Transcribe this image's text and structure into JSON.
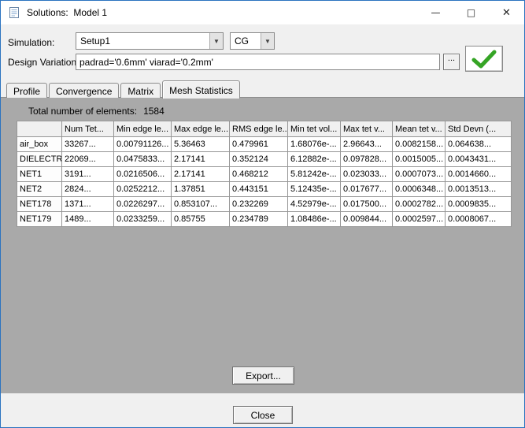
{
  "window": {
    "title": "Solutions:  Model 1",
    "minimize_glyph": "—",
    "maximize_glyph": "□",
    "close_glyph": "✕"
  },
  "icons": {
    "dropdown_arrow": "▼",
    "browse_ellipsis": "..."
  },
  "toolbar": {
    "simulation_label": "Simulation:",
    "simulation_value": "Setup1",
    "solution_type_value": "CG",
    "design_variation_label": "Design Variation:",
    "design_variation_value": "padrad='0.6mm' viarad='0.2mm'",
    "accent_green": "#35a425"
  },
  "tabs": [
    {
      "label": "Profile",
      "selected": false
    },
    {
      "label": "Convergence",
      "selected": false
    },
    {
      "label": "Matrix",
      "selected": false
    },
    {
      "label": "Mesh Statistics",
      "selected": true
    }
  ],
  "mesh_statistics": {
    "total_label": "Total number of elements:",
    "total_value": "1584",
    "columns": [
      "",
      "Num Tet...",
      "Min edge le...",
      "Max edge le...",
      "RMS edge le...",
      "Min tet vol...",
      "Max tet v...",
      "Mean tet v...",
      "Std Devn (..."
    ],
    "rows": [
      {
        "name": "air_box",
        "values": [
          "33267...",
          "0.00791126...",
          "5.36463",
          "0.479961",
          "1.68076e-...",
          "2.96643...",
          "0.0082158...",
          "0.064638..."
        ]
      },
      {
        "name": "DIELECTRIC",
        "values": [
          "22069...",
          "0.0475833...",
          "2.17141",
          "0.352124",
          "6.12882e-...",
          "0.097828...",
          "0.0015005...",
          "0.0043431..."
        ]
      },
      {
        "name": "NET1",
        "values": [
          "3191...",
          "0.0216506...",
          "2.17141",
          "0.468212",
          "5.81242e-...",
          "0.023033...",
          "0.0007073...",
          "0.0014660..."
        ]
      },
      {
        "name": "NET2",
        "values": [
          "2824...",
          "0.0252212...",
          "1.37851",
          "0.443151",
          "5.12435e-...",
          "0.017677...",
          "0.0006348...",
          "0.0013513..."
        ]
      },
      {
        "name": "NET178",
        "values": [
          "1371...",
          "0.0226297...",
          "0.853107...",
          "0.232269",
          "4.52979e-...",
          "0.017500...",
          "0.0002782...",
          "0.0009835..."
        ]
      },
      {
        "name": "NET179",
        "values": [
          "1489...",
          "0.0233259...",
          "0.85755",
          "0.234789",
          "1.08486e-...",
          "0.009844...",
          "0.0002597...",
          "0.0008067..."
        ]
      }
    ]
  },
  "buttons": {
    "export": "Export...",
    "close": "Close"
  }
}
